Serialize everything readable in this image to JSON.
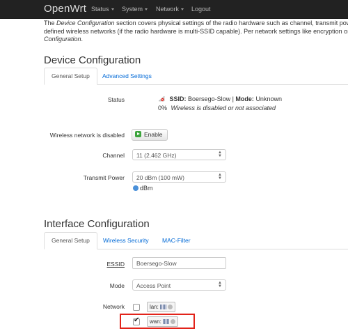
{
  "nav": {
    "brand": "OpenWrt",
    "items": [
      "Status",
      "System",
      "Network",
      "Logout"
    ]
  },
  "intro": {
    "line1_pre": "The ",
    "line1_em": "Device Configuration",
    "line1_post": " section covers physical settings of the radio hardware such as channel, transmit power or a",
    "line2": "defined wireless networks (if the radio hardware is multi-SSID capable). Per network settings like encryption or operat",
    "line3_em": "Configuration",
    "line3_post": "."
  },
  "device_config": {
    "title": "Device Configuration",
    "tabs": [
      "General Setup",
      "Advanced Settings"
    ],
    "status_label": "Status",
    "status_ssid_prefix": "SSID:",
    "status_ssid": "Boersego-Slow",
    "status_sep": " | ",
    "status_mode_prefix": "Mode:",
    "status_mode": "Unknown",
    "status_percent": "0%",
    "status_note": "Wireless is disabled or not associated",
    "disabled_label": "Wireless network is disabled",
    "enable_button": "Enable",
    "channel_label": "Channel",
    "channel_value": "11 (2.462 GHz)",
    "power_label": "Transmit Power",
    "power_value": "20 dBm (100 mW)",
    "power_unit": "dBm"
  },
  "interface_config": {
    "title": "Interface Configuration",
    "tabs": [
      "General Setup",
      "Wireless Security",
      "MAC-Filter"
    ],
    "essid_label": "ESSID",
    "essid_value": "Boersego-Slow",
    "mode_label": "Mode",
    "mode_value": "Access Point",
    "network_label": "Network",
    "networks": [
      {
        "name": "lan:",
        "checked": false
      },
      {
        "name": "wan:",
        "checked": true
      }
    ]
  },
  "colors": {
    "navbar": "#222222",
    "link": "#0069d6",
    "highlight": "#e2231a",
    "enable_icon": "#3ca43c"
  }
}
